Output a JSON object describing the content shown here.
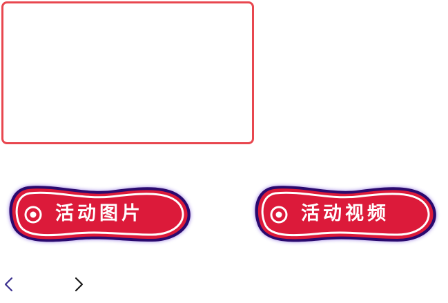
{
  "colors": {
    "frame_border": "#e8474f",
    "button_fill": "#dc1a3a",
    "button_outline": "#2a0a6e",
    "button_glow": "#8a6be0",
    "button_inner_ring": "#ffffff",
    "prev_arrow": "#3a2f8f",
    "next_arrow": "#1a1a1a"
  },
  "media_frame": {
    "state": "empty"
  },
  "buttons": {
    "photos": {
      "label": "活动图片",
      "icon": "target-icon"
    },
    "videos": {
      "label": "活动视频",
      "icon": "target-icon"
    }
  },
  "navigation": {
    "prev_icon": "chevron-left-icon",
    "next_icon": "chevron-right-icon"
  }
}
